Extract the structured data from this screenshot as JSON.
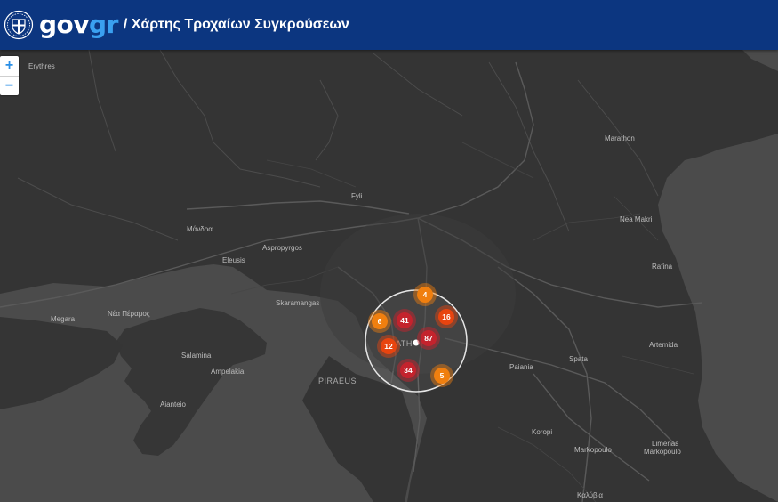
{
  "header": {
    "logo_gov": "gov",
    "logo_gr": "gr",
    "title": "/ Χάρτης Τροχαίων Συγκρούσεων"
  },
  "zoom": {
    "in_label": "+",
    "out_label": "−"
  },
  "places": {
    "erythres": "Erythres",
    "marathon": "Marathon",
    "fyli": "Fyli",
    "mandra": "Μάνδρα",
    "aspropyrgos": "Aspropyrgos",
    "nea_makri": "Nea Makri",
    "eleusis": "Eleusis",
    "rafina": "Rafina",
    "skaramangas": "Skaramangas",
    "megara": "Megara",
    "nea_peramos": "Νέα Πέραμος",
    "artemida": "Artemida",
    "athens": "ATH",
    "salamina": "Salamina",
    "paiania": "Paiania",
    "spata": "Spata",
    "ampelakia": "Ampelakia",
    "piraeus": "PIRAEUS",
    "aianteio": "Aianteio",
    "koropi": "Koropi",
    "limenas": "Limenas",
    "markopoulo": "Markopoulo",
    "markopoulo2": "Markopoulo",
    "kalyvia": "Καλύβια"
  },
  "clusters": [
    {
      "label": "4",
      "kind": "orange"
    },
    {
      "label": "6",
      "kind": "orange"
    },
    {
      "label": "41",
      "kind": "red"
    },
    {
      "label": "16",
      "kind": "orangered"
    },
    {
      "label": "87",
      "kind": "red"
    },
    {
      "label": "12",
      "kind": "orangered"
    },
    {
      "label": "34",
      "kind": "red"
    },
    {
      "label": "5",
      "kind": "orange"
    }
  ],
  "colors": {
    "header": "#0c3680",
    "gr_accent": "#3aa0f0",
    "land": "#333333",
    "sea": "#4a4a4a",
    "cluster_orange": "#f07f0f",
    "cluster_orangered": "#e8440f",
    "cluster_red": "#c4232d"
  }
}
